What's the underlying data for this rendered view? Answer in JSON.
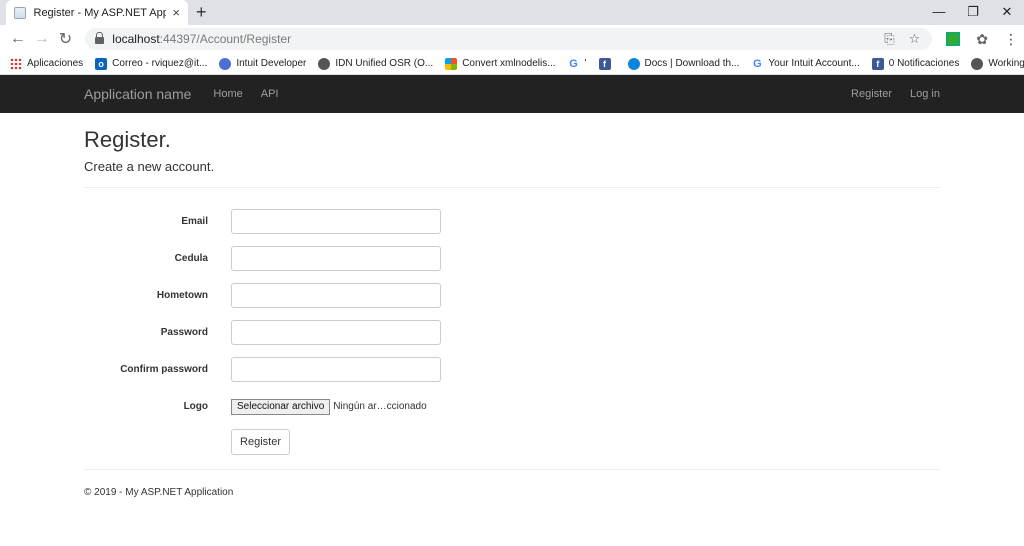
{
  "browser": {
    "tab_title": "Register - My ASP.NET Application",
    "tab_close": "×",
    "new_tab": "+",
    "window_controls": [
      "—",
      "❐",
      "✕"
    ],
    "url_host": "localhost",
    "url_rest": ":44397/Account/Register",
    "bookmarks": [
      {
        "label": "Aplicaciones",
        "icon": "apps-icon"
      },
      {
        "label": "Correo - rviquez@it...",
        "icon": "outlook-icon"
      },
      {
        "label": "Intuit Developer",
        "icon": "intuit-icon"
      },
      {
        "label": "IDN Unified OSR (O...",
        "icon": "globe-icon"
      },
      {
        "label": "Convert xmlnodelis...",
        "icon": "microsoft-icon"
      },
      {
        "label": "'",
        "icon": "google-icon"
      },
      {
        "label": "",
        "icon": "facebook-icon"
      },
      {
        "label": "Docs | Download th...",
        "icon": "edge-icon"
      },
      {
        "label": "Your Intuit Account...",
        "icon": "google-icon"
      },
      {
        "label": "0 Notificaciones",
        "icon": "facebook-icon"
      },
      {
        "label": "Working...",
        "icon": "globe-icon"
      }
    ],
    "bookmarks_more": "»"
  },
  "navbar": {
    "brand": "Application name",
    "links": [
      "Home",
      "API"
    ],
    "right_links": [
      "Register",
      "Log in"
    ]
  },
  "page": {
    "title": "Register.",
    "subtitle": "Create a new account."
  },
  "form": {
    "email_label": "Email",
    "cedula_label": "Cedula",
    "hometown_label": "Hometown",
    "password_label": "Password",
    "confirm_label": "Confirm password",
    "logo_label": "Logo",
    "file_button": "Seleccionar archivo",
    "file_status": "Ningún ar…ccionado",
    "submit_label": "Register"
  },
  "footer": {
    "text": "© 2019 - My ASP.NET Application"
  }
}
